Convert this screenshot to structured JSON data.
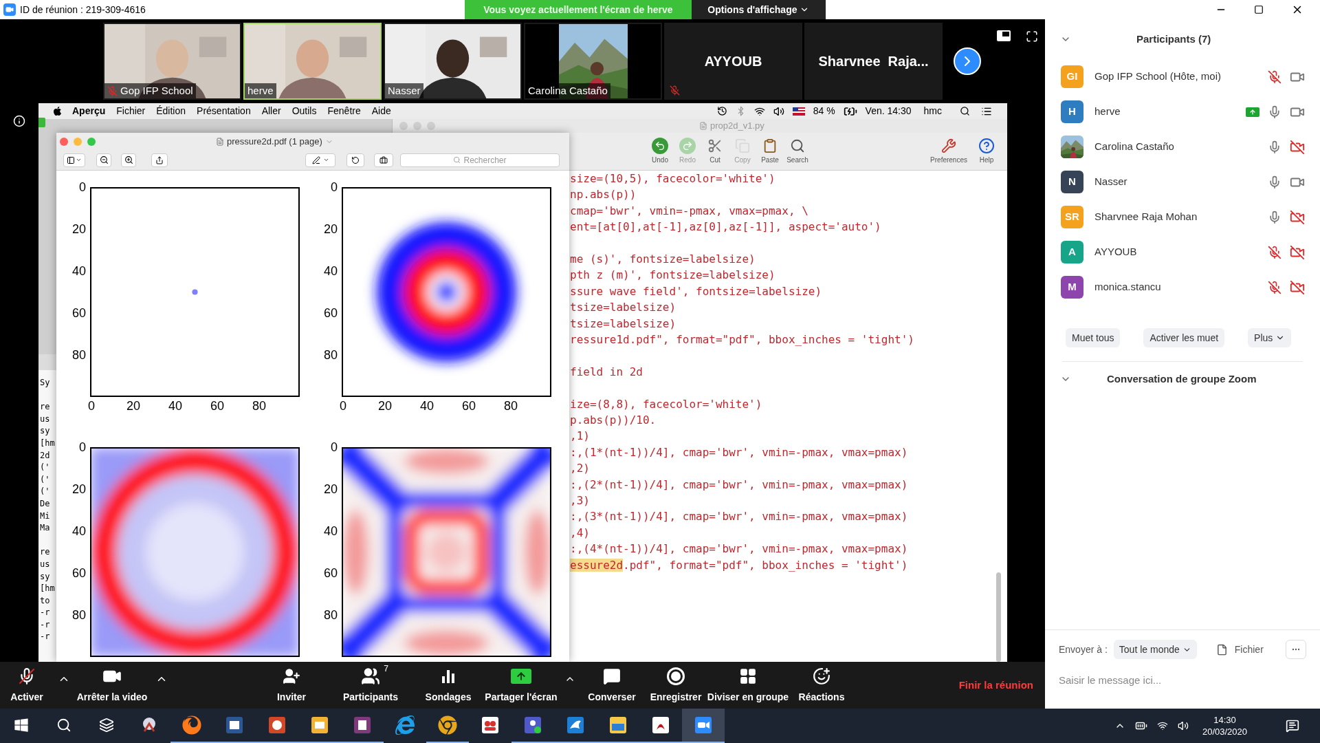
{
  "title_bar": {
    "meeting_id": "ID de réunion : 219-309-4616",
    "banner": "Vous voyez actuellement l'écran de herve",
    "view_options": "Options d'affichage"
  },
  "video_tiles": [
    {
      "kind": "video",
      "name": "Gop IFP School",
      "muted": true,
      "selected": false
    },
    {
      "kind": "video",
      "name": "herve",
      "muted": false,
      "selected": true
    },
    {
      "kind": "video",
      "name": "Nasser",
      "muted": false,
      "selected": false
    },
    {
      "name": "Carolina Castaño",
      "muted": false,
      "selected": false
    },
    {
      "kind": "name",
      "name": "AYYOUB",
      "muted": true,
      "selected": false
    },
    {
      "kind": "name",
      "name": "Sharvnee  Raja...",
      "muted": false,
      "selected": false
    }
  ],
  "shared_screen": {
    "menu_bar": {
      "items": [
        {
          "label": "Aperçu",
          "kind": "app"
        },
        {
          "label": "Fichier",
          "kind": "menu"
        },
        {
          "label": "Édition",
          "kind": "menu"
        },
        {
          "label": "Présentation",
          "kind": "menu"
        },
        {
          "label": "Aller",
          "kind": "menu"
        },
        {
          "label": "Outils",
          "kind": "menu"
        },
        {
          "label": "Fenêtre",
          "kind": "menu"
        },
        {
          "label": "Aide",
          "kind": "menu"
        }
      ],
      "battery": "84 %",
      "clock": "Ven. 14:30",
      "user": "hmc"
    },
    "terminal": {
      "blocks": [
        [
          "Sy"
        ],
        [
          "re",
          "us",
          "sy",
          "[hm",
          "2d",
          "('",
          "('",
          "('",
          "De",
          "Mi",
          "Ma"
        ],
        [
          "re",
          "us",
          "sy",
          "[hm",
          "to",
          "-r",
          "-r",
          "-r"
        ]
      ]
    },
    "editor": {
      "title": "prop2d_v1.py",
      "tools": [
        {
          "label": "Undo",
          "kind": "undo",
          "disabled": false
        },
        {
          "label": "Redo",
          "kind": "redo",
          "disabled": true
        },
        {
          "label": "Cut",
          "kind": "cut",
          "disabled": false
        },
        {
          "label": "Copy",
          "kind": "copy",
          "disabled": true
        },
        {
          "label": "Paste",
          "kind": "paste",
          "disabled": false
        },
        {
          "label": "Search",
          "kind": "search",
          "disabled": false
        }
      ],
      "right_tools": [
        {
          "label": "Preferences",
          "kind": "preferences"
        },
        {
          "label": "Help",
          "kind": "help"
        }
      ],
      "blocks": [
        [
          {
            "text": "size=(10,5), facecolor='white')"
          },
          {
            "text": "np.abs(p))"
          },
          {
            "text": "cmap='bwr', vmin=-pmax, vmax=pmax, \\"
          },
          {
            "text": "ent=[at[0],at[-1],az[0],az[-1]], aspect='auto')"
          }
        ],
        [
          {
            "text": "me (s)', fontsize=labelsize)"
          },
          {
            "text": "pth z (m)', fontsize=labelsize)"
          },
          {
            "text": "ssure wave field', fontsize=labelsize)"
          },
          {
            "text": "tsize=labelsize)"
          },
          {
            "text": "tsize=labelsize)"
          },
          {
            "text": "ressure1d.pdf\", format=\"pdf\", bbox_inches = 'tight')"
          }
        ],
        [
          {
            "text": "field in 2d"
          }
        ],
        [
          {
            "text": "ize=(8,8), facecolor='white')"
          },
          {
            "text": "p.abs(p))/10."
          },
          {
            "text": ",1)"
          },
          {
            "text": ":,(1*(nt-1))/4], cmap='bwr', vmin=-pmax, vmax=pmax)"
          },
          {
            "text": ",2)"
          },
          {
            "text": ":,(2*(nt-1))/4], cmap='bwr', vmin=-pmax, vmax=pmax)"
          },
          {
            "text": ",3)"
          },
          {
            "text": ":,(3*(nt-1))/4], cmap='bwr', vmin=-pmax, vmax=pmax)"
          },
          {
            "text": ",4)"
          },
          {
            "text": ":,(4*(nt-1))/4], cmap='bwr', vmin=-pmax, vmax=pmax)"
          },
          {
            "marked": "essure2d",
            "text": ".pdf\", format=\"pdf\", bbox_inches = 'tight')"
          }
        ]
      ]
    },
    "preview": {
      "title": "pressure2d.pdf (1 page)",
      "search_placeholder": "Rechercher",
      "plots": [
        {
          "kind": "dot",
          "yticks": [
            "0",
            "20",
            "40",
            "60",
            "80"
          ],
          "xticks": [
            "0",
            "20",
            "40",
            "60",
            "80"
          ]
        },
        {
          "kind": "rings",
          "yticks": [
            "0",
            "20",
            "40",
            "60",
            "80"
          ],
          "xticks": [
            "0",
            "20",
            "40",
            "60",
            "80"
          ]
        },
        {
          "kind": "ring",
          "yticks": [
            "0",
            "20",
            "40",
            "60",
            "80"
          ]
        },
        {
          "kind": "grid",
          "yticks": [
            "0",
            "20",
            "40",
            "60",
            "80"
          ]
        }
      ]
    }
  },
  "meeting_toolbar": {
    "items": [
      {
        "kind": "mic",
        "label": "Activer",
        "muted": true
      },
      {
        "kind": "caret"
      },
      {
        "kind": "video",
        "label": "Arrêter la video"
      },
      {
        "kind": "caret"
      },
      {
        "kind": "invite",
        "label": "Inviter"
      },
      {
        "kind": "participants",
        "label": "Participants",
        "count": "7"
      },
      {
        "kind": "polls",
        "label": "Sondages"
      },
      {
        "kind": "share",
        "label": "Partager l'écran"
      },
      {
        "kind": "caret"
      },
      {
        "kind": "chat",
        "label": "Converser"
      },
      {
        "kind": "record",
        "label": "Enregistrer"
      },
      {
        "kind": "breakout",
        "label": "Diviser en groupe"
      },
      {
        "kind": "reactions",
        "label": "Réactions"
      }
    ],
    "end": "Finir la réunion"
  },
  "participants_panel": {
    "title": "Participants (7)",
    "participants": [
      {
        "kind": "initials",
        "initials": "GI",
        "color": "#f4a11d",
        "name": "Gop IFP School (Hôte, moi)",
        "mic_muted": true,
        "video_off": false,
        "sharing": false
      },
      {
        "kind": "initials",
        "initials": "H",
        "color": "#2e7dc1",
        "name": "herve",
        "mic_muted": false,
        "video_off": false,
        "sharing": true
      },
      {
        "name": "Carolina Castaño",
        "mic_muted": false,
        "video_off": true,
        "sharing": false
      },
      {
        "kind": "initials",
        "initials": "N",
        "color": "#374357",
        "name": "Nasser",
        "mic_muted": false,
        "video_off": false,
        "sharing": false
      },
      {
        "kind": "initials",
        "initials": "SR",
        "color": "#f4a11d",
        "name": "Sharvnee Raja Mohan",
        "mic_muted": false,
        "video_off": true,
        "sharing": false
      },
      {
        "kind": "initials",
        "initials": "A",
        "color": "#17a58a",
        "name": "AYYOUB",
        "mic_muted": true,
        "video_off": true,
        "sharing": false
      },
      {
        "kind": "initials",
        "initials": "M",
        "color": "#8e44ad",
        "name": "monica.stancu",
        "mic_muted": true,
        "video_off": true,
        "sharing": false
      }
    ],
    "buttons": [
      "Muet tous",
      "Activer les muet",
      "Plus"
    ],
    "chat_title": "Conversation de groupe Zoom",
    "send_to_label": "Envoyer à :",
    "send_to": "Tout le monde",
    "file": "Fichier",
    "message_placeholder": "Saisir le message ici..."
  },
  "taskbar": {
    "items": [
      {
        "kind": "start",
        "running": false,
        "selected": false
      },
      {
        "kind": "search",
        "running": false,
        "selected": false
      },
      {
        "kind": "taskview",
        "running": false,
        "selected": false
      },
      {
        "kind": "snip",
        "running": false,
        "selected": false
      },
      {
        "kind": "firefox",
        "running": true,
        "selected": false
      },
      {
        "kind": "word",
        "running": true,
        "selected": false
      },
      {
        "kind": "powerpoint",
        "running": true,
        "selected": false
      },
      {
        "kind": "outlook",
        "running": true,
        "selected": false
      },
      {
        "kind": "onenote",
        "running": true,
        "selected": false
      },
      {
        "kind": "ie",
        "running": false,
        "selected": false
      },
      {
        "kind": "chrome",
        "running": true,
        "selected": false
      },
      {
        "kind": "meeting",
        "running": false,
        "selected": false
      },
      {
        "kind": "teams",
        "running": true,
        "selected": false
      },
      {
        "kind": "bird",
        "running": true,
        "selected": false
      },
      {
        "kind": "explorer",
        "running": true,
        "selected": false
      },
      {
        "kind": "acrobat",
        "running": true,
        "selected": false
      },
      {
        "kind": "zoom",
        "running": true,
        "selected": true
      }
    ],
    "time": "14:30",
    "date": "20/03/2020"
  }
}
